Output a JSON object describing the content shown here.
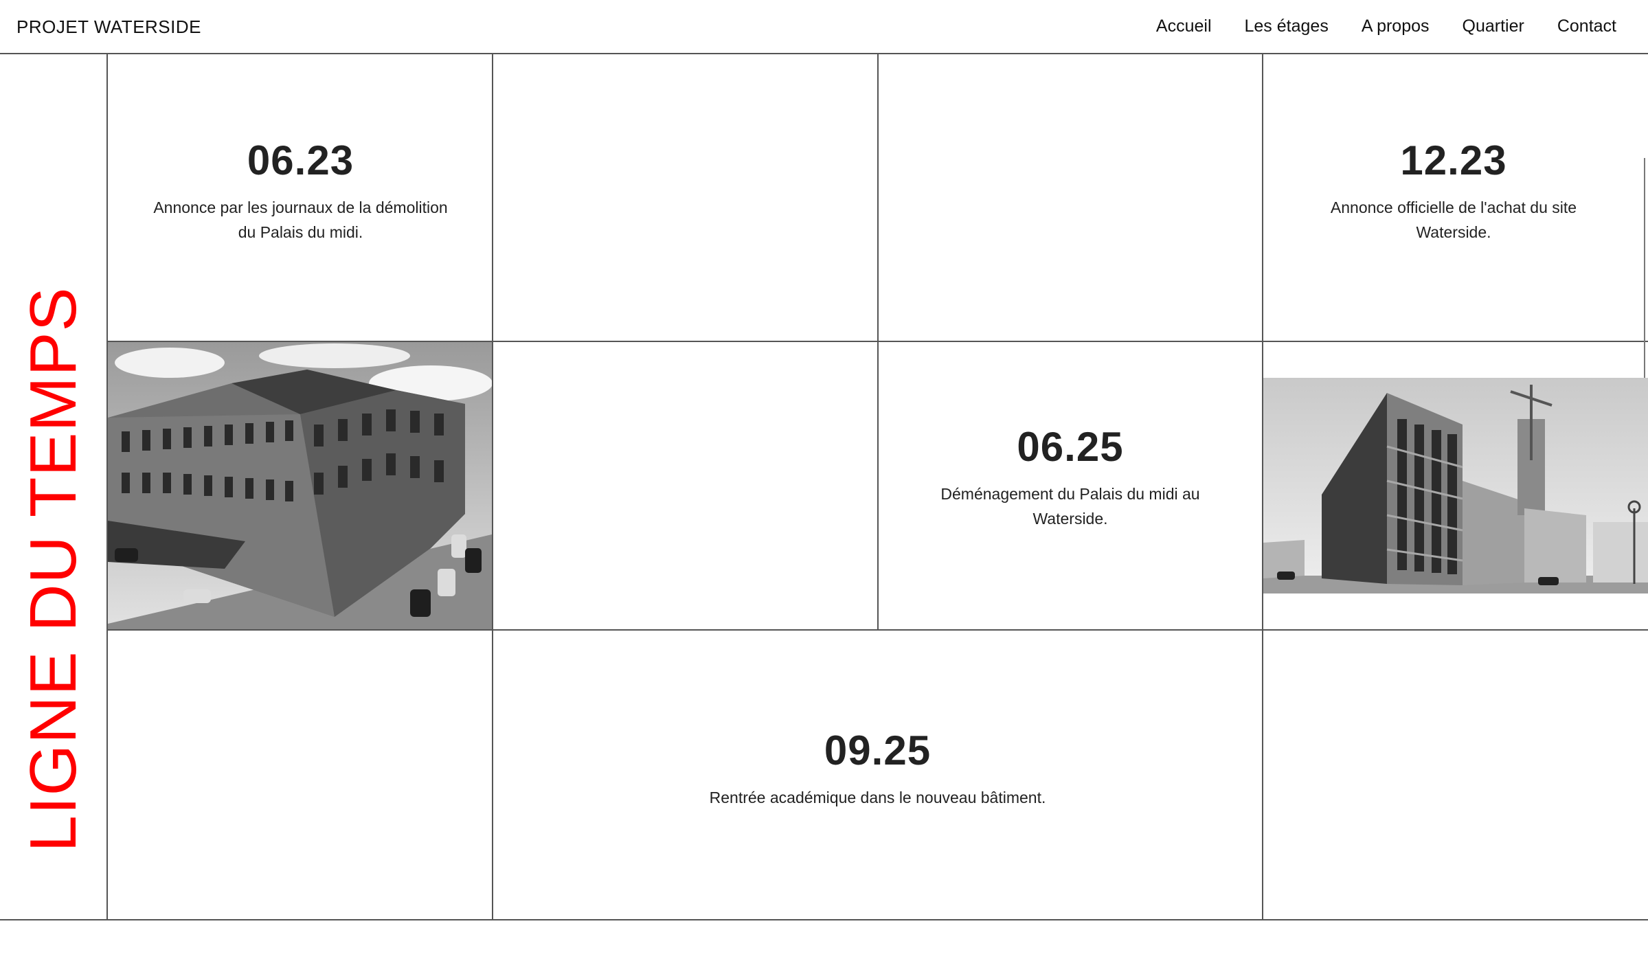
{
  "header": {
    "brand": "PROJET WATERSIDE",
    "nav": [
      "Accueil",
      "Les étages",
      "A propos",
      "Quartier",
      "Contact"
    ]
  },
  "sidebar": {
    "title": "LIGNE DU TEMPS"
  },
  "timeline": [
    {
      "date": "06.23",
      "text": "Annonce par les journaux de la démolition du Palais du midi."
    },
    {
      "date": "12.23",
      "text": "Annonce officielle de l'achat du site Waterside."
    },
    {
      "date": "06.25",
      "text": "Déménagement du Palais du midi au Waterside."
    },
    {
      "date": "09.25",
      "text": "Rentrée académique dans le nouveau bâtiment."
    }
  ],
  "images": {
    "old_building": "palais-du-midi-photo",
    "new_building": "waterside-building-photo"
  },
  "colors": {
    "accent": "#ff0000",
    "text": "#222222",
    "grid": "#555555"
  }
}
